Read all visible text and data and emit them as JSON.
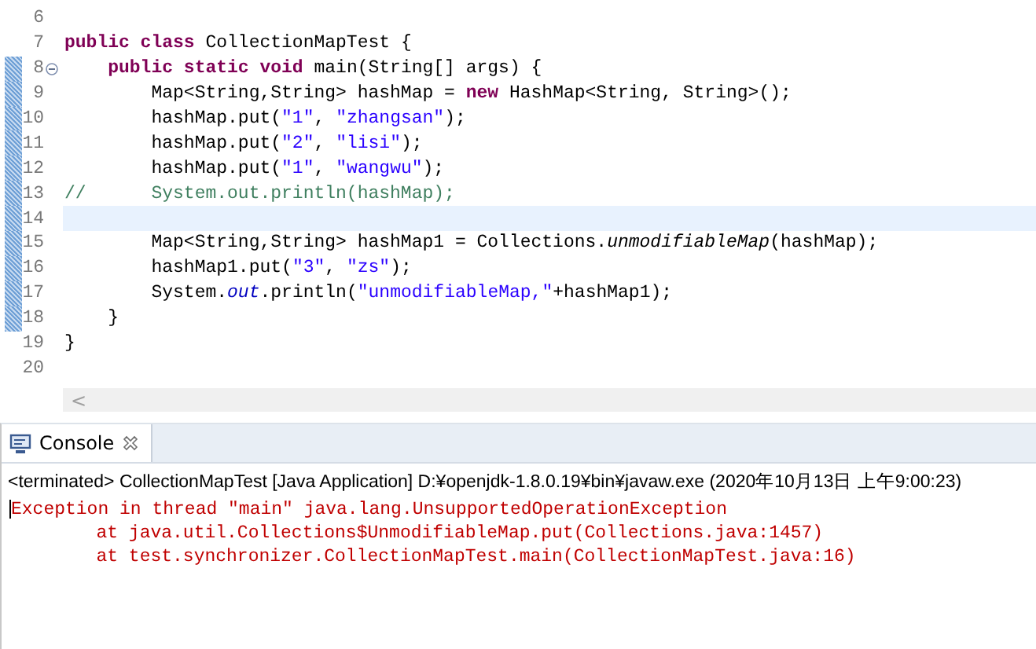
{
  "editor": {
    "lines": [
      {
        "number": "6",
        "changed": false,
        "current": false,
        "fold": false
      },
      {
        "number": "7",
        "changed": false,
        "current": false,
        "fold": false,
        "tokens": [
          {
            "kind": "keyword",
            "text": "public class "
          },
          {
            "kind": "plain",
            "text": "CollectionMapTest {"
          }
        ]
      },
      {
        "number": "8",
        "changed": true,
        "current": false,
        "fold": true,
        "tokens": [
          {
            "kind": "keyword",
            "text": "    public static void "
          },
          {
            "kind": "plain",
            "text": "main(String[] args) {"
          }
        ]
      },
      {
        "number": "9",
        "changed": true,
        "current": false,
        "fold": false,
        "tokens": [
          {
            "kind": "plain",
            "text": "        Map<String,String> hashMap = "
          },
          {
            "kind": "keyword",
            "text": "new"
          },
          {
            "kind": "plain",
            "text": " HashMap<String, String>();"
          }
        ]
      },
      {
        "number": "10",
        "changed": true,
        "current": false,
        "fold": false,
        "tokens": [
          {
            "kind": "plain",
            "text": "        hashMap.put("
          },
          {
            "kind": "string",
            "text": "\"1\""
          },
          {
            "kind": "plain",
            "text": ", "
          },
          {
            "kind": "string",
            "text": "\"zhangsan\""
          },
          {
            "kind": "plain",
            "text": ");"
          }
        ]
      },
      {
        "number": "11",
        "changed": true,
        "current": false,
        "fold": false,
        "tokens": [
          {
            "kind": "plain",
            "text": "        hashMap.put("
          },
          {
            "kind": "string",
            "text": "\"2\""
          },
          {
            "kind": "plain",
            "text": ", "
          },
          {
            "kind": "string",
            "text": "\"lisi\""
          },
          {
            "kind": "plain",
            "text": ");"
          }
        ]
      },
      {
        "number": "12",
        "changed": true,
        "current": false,
        "fold": false,
        "tokens": [
          {
            "kind": "plain",
            "text": "        hashMap.put("
          },
          {
            "kind": "string",
            "text": "\"1\""
          },
          {
            "kind": "plain",
            "text": ", "
          },
          {
            "kind": "string",
            "text": "\"wangwu\""
          },
          {
            "kind": "plain",
            "text": ");"
          }
        ]
      },
      {
        "number": "13",
        "changed": true,
        "current": false,
        "fold": false,
        "tokens": [
          {
            "kind": "comment",
            "text": "//      System.out.println(hashMap);"
          }
        ]
      },
      {
        "number": "14",
        "changed": true,
        "current": true,
        "fold": false
      },
      {
        "number": "15",
        "changed": true,
        "current": false,
        "fold": false,
        "tokens": [
          {
            "kind": "plain",
            "text": "        Map<String,String> hashMap1 = Collections."
          },
          {
            "kind": "static",
            "text": "unmodifiableMap"
          },
          {
            "kind": "plain",
            "text": "(hashMap);"
          }
        ]
      },
      {
        "number": "16",
        "changed": true,
        "current": false,
        "fold": false,
        "tokens": [
          {
            "kind": "plain",
            "text": "        hashMap1.put("
          },
          {
            "kind": "string",
            "text": "\"3\""
          },
          {
            "kind": "plain",
            "text": ", "
          },
          {
            "kind": "string",
            "text": "\"zs\""
          },
          {
            "kind": "plain",
            "text": ");"
          }
        ]
      },
      {
        "number": "17",
        "changed": true,
        "current": false,
        "fold": false,
        "tokens": [
          {
            "kind": "plain",
            "text": "        System."
          },
          {
            "kind": "field",
            "text": "out"
          },
          {
            "kind": "plain",
            "text": ".println("
          },
          {
            "kind": "string",
            "text": "\"unmodifiableMap,\""
          },
          {
            "kind": "plain",
            "text": "+hashMap1);"
          }
        ]
      },
      {
        "number": "18",
        "changed": true,
        "current": false,
        "fold": false,
        "tokens": [
          {
            "kind": "plain",
            "text": "    }"
          }
        ]
      },
      {
        "number": "19",
        "changed": false,
        "current": false,
        "fold": false,
        "tokens": [
          {
            "kind": "plain",
            "text": "}"
          }
        ]
      },
      {
        "number": "20",
        "changed": false,
        "current": false,
        "fold": false
      }
    ],
    "scroll_left": "<"
  },
  "console": {
    "tabs": [
      {
        "label": "Console",
        "selected": true
      }
    ],
    "header": "<terminated> CollectionMapTest [Java Application] D:¥openjdk-1.8.0.19¥bin¥javaw.exe (2020年10月13日 上午9:00:23)",
    "output": [
      {
        "text": "Exception in thread \"main\" java.lang.UnsupportedOperationException",
        "indent": false
      },
      {
        "text": "at java.util.Collections$UnmodifiableMap.put(Collections.java:1457)",
        "indent": true
      },
      {
        "text": "at test.synchronizer.CollectionMapTest.main(CollectionMapTest.java:16)",
        "indent": true
      }
    ]
  }
}
